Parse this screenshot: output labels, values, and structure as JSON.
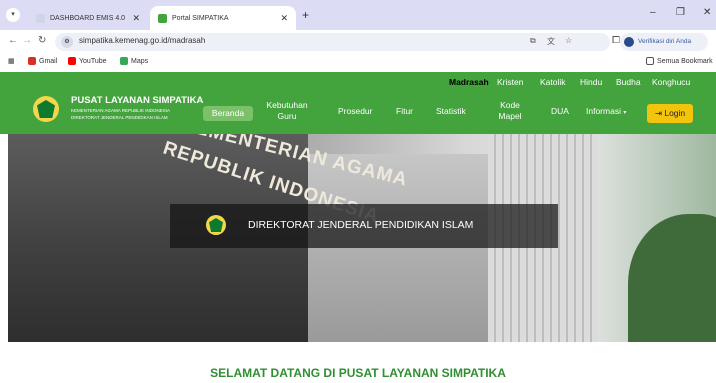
{
  "browser": {
    "tabs": [
      {
        "label": "DASHBOARD EMIS 4.0",
        "active": false
      },
      {
        "label": "Portal SIMPATIKA",
        "active": true
      }
    ],
    "url": "simpatika.kemenag.go.id/madrasah",
    "profile_label": "Verifikasi diri Anda",
    "bookmarks": [
      {
        "label": "Gmail",
        "color": "#d93025"
      },
      {
        "label": "YouTube",
        "color": "#ff0000"
      },
      {
        "label": "Maps",
        "color": "#34a853"
      }
    ],
    "all_bookmarks_label": "Semua Bookmark"
  },
  "site": {
    "brand_title": "PUSAT LAYANAN SIMPATIKA",
    "brand_sub1": "KEMENTERIAN AGAMA REPUBLIK INDONESIA",
    "brand_sub2": "DIREKTORAT JENDERAL PENDIDIKAN ISLAM",
    "top_links": [
      "Madrasah",
      "Kristen",
      "Katolik",
      "Hindu",
      "Budha",
      "Konghucu"
    ],
    "nav": {
      "beranda": "Beranda",
      "kebutuhan_1": "Kebutuhan",
      "kebutuhan_2": "Guru",
      "prosedur": "Prosedur",
      "fitur": "Fitur",
      "statistik": "Statistik",
      "kode_1": "Kode",
      "kode_2": "Mapel",
      "dua": "DUA",
      "informasi": "Informasi",
      "login": "Login"
    },
    "hero_caption": "DIREKTORAT JENDERAL PENDIDIKAN ISLAM",
    "hero_sign_line1": "KEMENTERIAN AGAMA",
    "hero_sign_line2": "REPUBLIK INDONESIA",
    "welcome": "SELAMAT DATANG DI PUSAT LAYANAN SIMPATIKA"
  },
  "colors": {
    "header_green": "#43a33c",
    "login_yellow": "#f2c40e",
    "welcome_green": "#2f8f31"
  }
}
